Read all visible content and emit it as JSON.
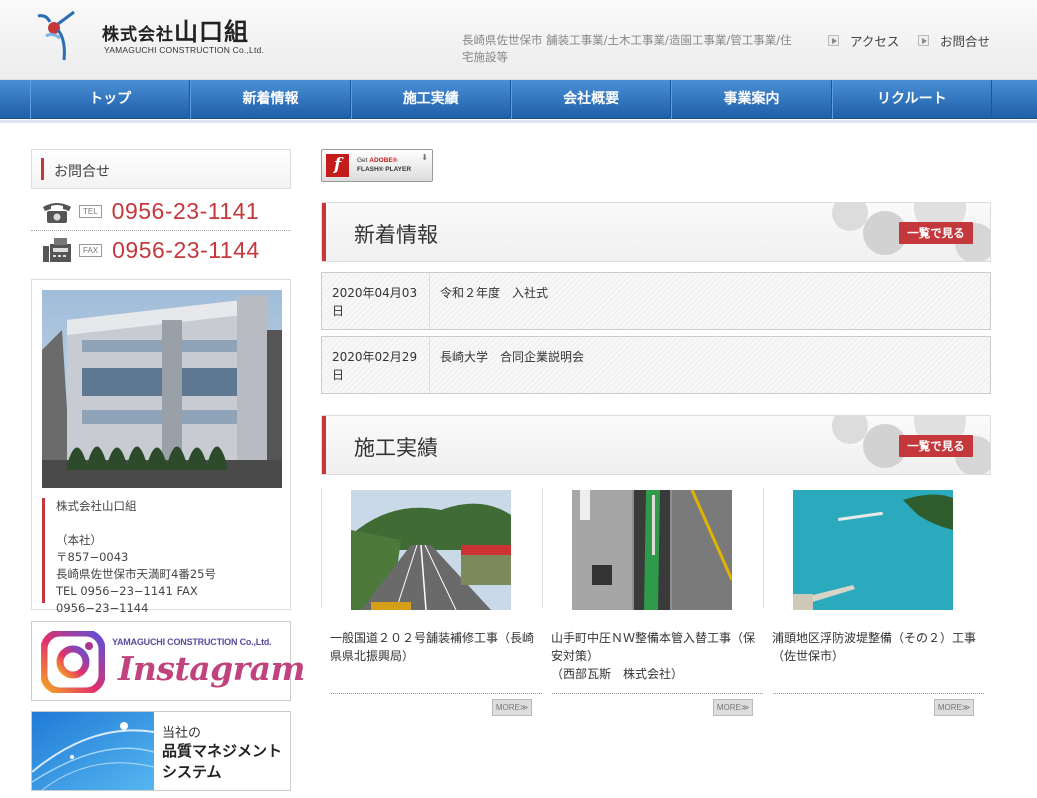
{
  "header": {
    "company_name": "株式会社",
    "company_name_main": "山口組",
    "company_name_en": "YAMAGUCHI CONSTRUCTION Co.,Ltd.",
    "tagline": "長崎県佐世保市 舗装工事業/土木工事業/造園工事業/管工事業/住宅施設等",
    "links": [
      {
        "label": "アクセス",
        "icon": "play-arrow-icon"
      },
      {
        "label": "お問合せ",
        "icon": "play-arrow-icon"
      }
    ]
  },
  "nav": {
    "items": [
      "トップ",
      "新着情報",
      "施工実績",
      "会社概要",
      "事業案内",
      "リクルート"
    ]
  },
  "sidebar": {
    "contact_heading": "お問合せ",
    "tel": {
      "tag": "TEL",
      "number": "0956-23-1141",
      "icon": "telephone-icon"
    },
    "fax": {
      "tag": "FAX",
      "number": "0956-23-1144",
      "icon": "fax-icon"
    },
    "address": {
      "company": "株式会社山口組",
      "branch": "（本社）",
      "postal": "〒857−0043",
      "street": "長崎県佐世保市天満町4番25号",
      "tel_fax": "TEL 0956−23−1141 FAX 0956−23−1144"
    },
    "instagram": {
      "company_en": "YAMAGUCHI CONSTRUCTION Co.,Ltd.",
      "word": "Instagram",
      "icon": "instagram-icon"
    },
    "quality": {
      "line1": "当社の",
      "line2": "品質マネジメント",
      "line3": "システム"
    }
  },
  "main": {
    "flash_badge": {
      "line1_prefix": "Get ",
      "line1_brand": "ADOBE®",
      "line2": "FLASH® PLAYER",
      "logo_letter": "f"
    },
    "news": {
      "title": "新着情報",
      "view_all": "一覧で見る",
      "items": [
        {
          "date": "2020年04月03日",
          "title": "令和２年度　入社式"
        },
        {
          "date": "2020年02月29日",
          "title": "長崎大学　合同企業説明会"
        }
      ]
    },
    "works": {
      "title": "施工実績",
      "view_all": "一覧で見る",
      "more_label": "MORE≫",
      "items": [
        {
          "title": "一般国道２０２号舗装補修工事（長崎県県北振興局）"
        },
        {
          "title": "山手町中圧ＮＷ整備本管入替工事（保安対策）\n（西部瓦斯　株式会社）"
        },
        {
          "title": "浦頭地区浮防波堤整備（その２）工事（佐世保市）"
        }
      ]
    }
  },
  "colors": {
    "accent": "#c4373b",
    "nav_blue": "#2a6cb6"
  }
}
